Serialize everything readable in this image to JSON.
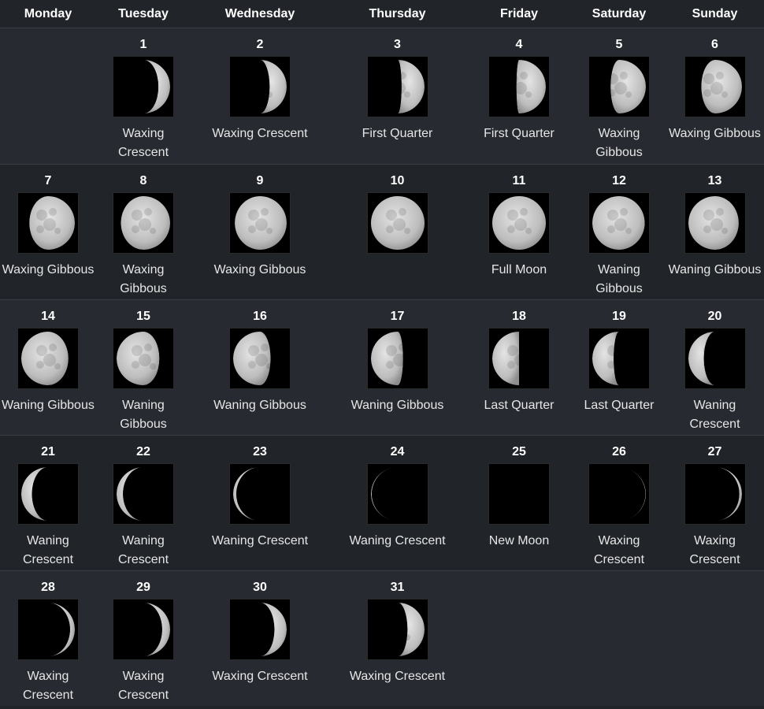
{
  "calendar": {
    "weekdays": [
      "Monday",
      "Tuesday",
      "Wednesday",
      "Thursday",
      "Friday",
      "Saturday",
      "Sunday"
    ],
    "days": [
      {
        "day": "1",
        "phase": "Waxing Crescent",
        "illum": 0.22,
        "waxing": true
      },
      {
        "day": "2",
        "phase": "Waxing Crescent",
        "illum": 0.32,
        "waxing": true
      },
      {
        "day": "3",
        "phase": "First Quarter",
        "illum": 0.43,
        "waxing": true
      },
      {
        "day": "4",
        "phase": "First Quarter",
        "illum": 0.55,
        "waxing": true
      },
      {
        "day": "5",
        "phase": "Waxing Gibbous",
        "illum": 0.66,
        "waxing": true
      },
      {
        "day": "6",
        "phase": "Waxing Gibbous",
        "illum": 0.76,
        "waxing": true
      },
      {
        "day": "7",
        "phase": "Waxing Gibbous",
        "illum": 0.85,
        "waxing": true
      },
      {
        "day": "8",
        "phase": "Waxing Gibbous",
        "illum": 0.92,
        "waxing": true
      },
      {
        "day": "9",
        "phase": "Waxing Gibbous",
        "illum": 0.97,
        "waxing": true
      },
      {
        "day": "10",
        "phase": "",
        "illum": 0.995,
        "waxing": true
      },
      {
        "day": "11",
        "phase": "Full Moon",
        "illum": 1.0,
        "waxing": false
      },
      {
        "day": "12",
        "phase": "Waning Gibbous",
        "illum": 0.98,
        "waxing": false
      },
      {
        "day": "13",
        "phase": "Waning Gibbous",
        "illum": 0.94,
        "waxing": false
      },
      {
        "day": "14",
        "phase": "Waning Gibbous",
        "illum": 0.88,
        "waxing": false
      },
      {
        "day": "15",
        "phase": "Waning Gibbous",
        "illum": 0.8,
        "waxing": false
      },
      {
        "day": "16",
        "phase": "Waning Gibbous",
        "illum": 0.7,
        "waxing": false
      },
      {
        "day": "17",
        "phase": "Waning Gibbous",
        "illum": 0.6,
        "waxing": false
      },
      {
        "day": "18",
        "phase": "Last Quarter",
        "illum": 0.5,
        "waxing": false
      },
      {
        "day": "19",
        "phase": "Last Quarter",
        "illum": 0.4,
        "waxing": false
      },
      {
        "day": "20",
        "phase": "Waning Crescent",
        "illum": 0.29,
        "waxing": false
      },
      {
        "day": "21",
        "phase": "Waning Crescent",
        "illum": 0.2,
        "waxing": false
      },
      {
        "day": "22",
        "phase": "Waning Crescent",
        "illum": 0.12,
        "waxing": false
      },
      {
        "day": "23",
        "phase": "Waning Crescent",
        "illum": 0.06,
        "waxing": false
      },
      {
        "day": "24",
        "phase": "Waning Crescent",
        "illum": 0.015,
        "waxing": false
      },
      {
        "day": "25",
        "phase": "New Moon",
        "illum": 0.0,
        "waxing": true
      },
      {
        "day": "26",
        "phase": "Waxing Crescent",
        "illum": 0.01,
        "waxing": true
      },
      {
        "day": "27",
        "phase": "Waxing Crescent",
        "illum": 0.05,
        "waxing": true
      },
      {
        "day": "28",
        "phase": "Waxing Crescent",
        "illum": 0.09,
        "waxing": true
      },
      {
        "day": "29",
        "phase": "Waxing Crescent",
        "illum": 0.15,
        "waxing": true
      },
      {
        "day": "30",
        "phase": "Waxing Crescent",
        "illum": 0.23,
        "waxing": true
      },
      {
        "day": "31",
        "phase": "Waxing Crescent",
        "illum": 0.32,
        "waxing": true
      }
    ]
  },
  "colors": {
    "page_bg": "#212429",
    "row_alt_bg": "#272a30",
    "moon_lit": "#c8c8c8",
    "moon_dark": "#000000"
  }
}
